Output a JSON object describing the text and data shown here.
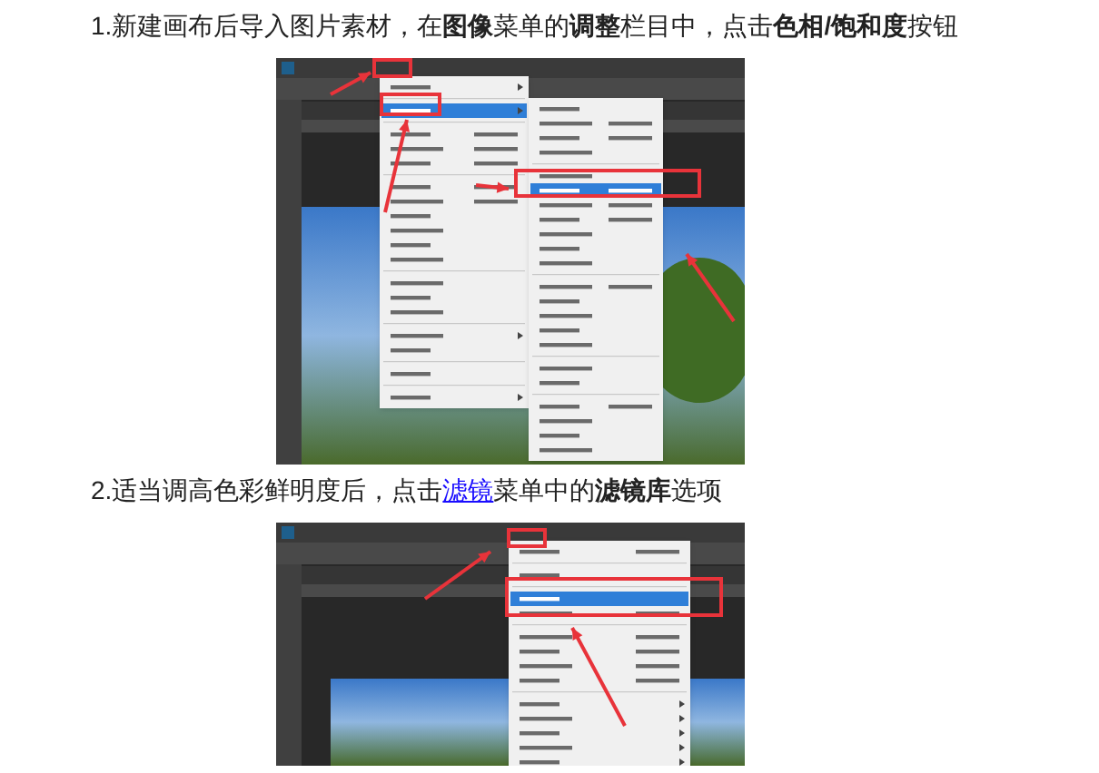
{
  "steps": [
    {
      "text": "1.新建画布后导入图片素材，在**图像**菜单的**调整**栏目中，点击**色相/饱和度**按钮",
      "screenshot": {
        "kind": "adjust-menu"
      }
    },
    {
      "text": "2.适当调高色彩鲜明度后，点击",
      "link": "滤镜",
      "after": "菜单中的**滤镜库**选项",
      "screenshot": {
        "kind": "filter-menu"
      }
    }
  ]
}
